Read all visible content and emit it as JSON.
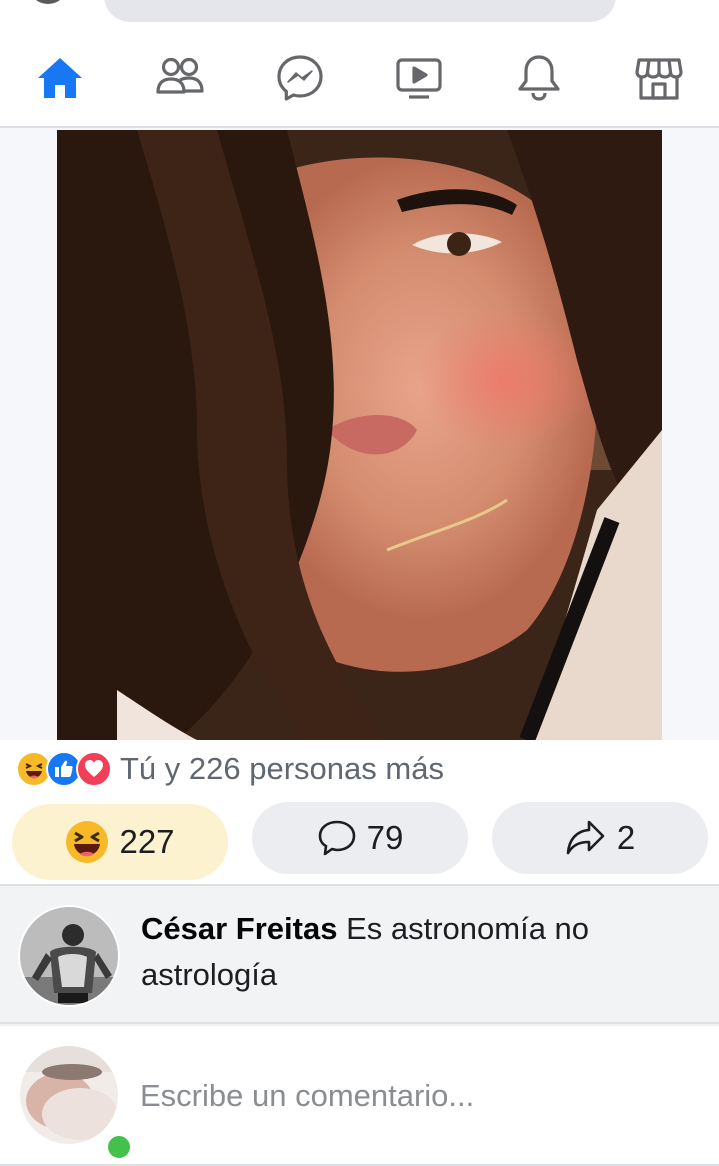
{
  "nav": {
    "items": [
      {
        "name": "home",
        "icon": "home-icon",
        "active": true
      },
      {
        "name": "friends",
        "icon": "friends-icon",
        "active": false
      },
      {
        "name": "messenger",
        "icon": "messenger-icon",
        "active": false
      },
      {
        "name": "watch",
        "icon": "video-icon",
        "active": false
      },
      {
        "name": "notifications",
        "icon": "bell-icon",
        "active": false
      },
      {
        "name": "marketplace",
        "icon": "store-icon",
        "active": false
      }
    ]
  },
  "colors": {
    "accent": "#1877f2",
    "icon_inactive": "#65676b",
    "haha_reaction": "#f7b928",
    "like_reaction": "#1877f2",
    "love_reaction": "#f33e58",
    "online": "#44c14a",
    "reacted_pill": "#fdf2cf"
  },
  "post": {
    "reactions_summary": "Tú y 226 personas más",
    "reaction_icons": [
      "haha-icon",
      "like-icon",
      "love-icon"
    ],
    "actions": {
      "reaction_count": "227",
      "comment_count": "79",
      "share_count": "2"
    }
  },
  "comments": [
    {
      "author": "César Freitas",
      "text": "Es astronomía no astrología"
    }
  ],
  "composer": {
    "placeholder": "Escribe un comentario..."
  }
}
